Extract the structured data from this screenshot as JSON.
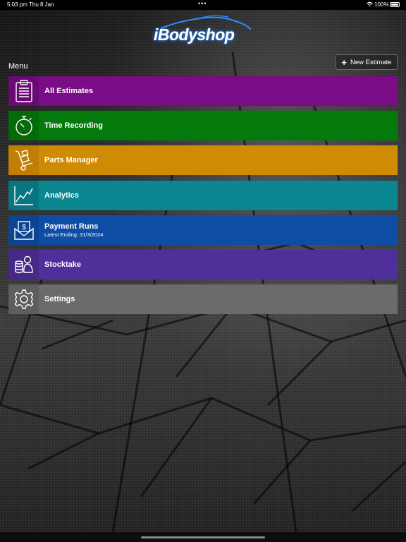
{
  "status_bar": {
    "time": "5:03 pm",
    "date": "Thu 8 Jan",
    "dots": "•••",
    "wifi_icon": "wifi-icon",
    "battery_pct": "100%"
  },
  "app": {
    "logo_text": "iBodyshop"
  },
  "menu": {
    "title": "Menu",
    "new_estimate_label": "New Estimate",
    "items": [
      {
        "label": "All Estimates",
        "sublabel": "",
        "icon": "clipboard-icon",
        "color": "#7a0d86",
        "icon_color": "#6a0b74"
      },
      {
        "label": "Time Recording",
        "sublabel": "",
        "icon": "stopwatch-icon",
        "color": "#057a0c",
        "icon_color": "#046a0a"
      },
      {
        "label": "Parts Manager",
        "sublabel": "",
        "icon": "hand-truck-icon",
        "color": "#d08b04",
        "icon_color": "#c07e03"
      },
      {
        "label": "Analytics",
        "sublabel": "",
        "icon": "line-chart-icon",
        "color": "#0a8791",
        "icon_color": "#087680"
      },
      {
        "label": "Payment Runs",
        "sublabel": "Latest Ending: 31/3/2024",
        "icon": "payment-envelope-icon",
        "color": "#0f4ca3",
        "icon_color": "#0d4390"
      },
      {
        "label": "Stocktake",
        "sublabel": "",
        "icon": "coins-person-icon",
        "color": "#4f2f9a",
        "icon_color": "#452888"
      },
      {
        "label": "Settings",
        "sublabel": "",
        "icon": "gear-icon",
        "color": "#6b6b6b",
        "icon_color": "#5e5e5e"
      }
    ]
  }
}
